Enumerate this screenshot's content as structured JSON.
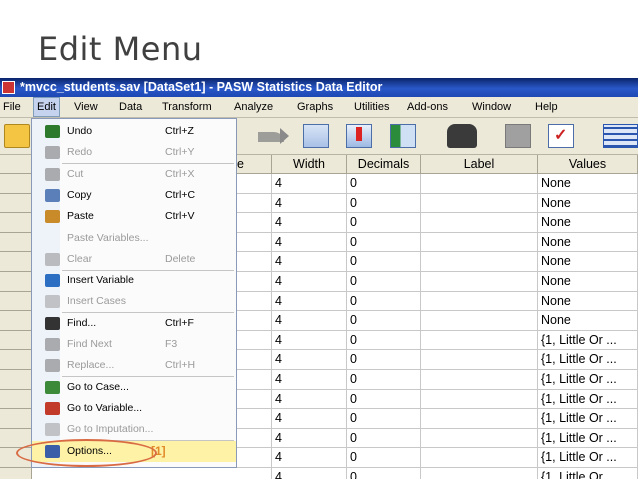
{
  "slide": {
    "title": "Edit Menu"
  },
  "window": {
    "title": "*mvcc_students.sav [DataSet1] - PASW Statistics Data Editor"
  },
  "menubar": {
    "items": [
      "File",
      "Edit",
      "View",
      "Data",
      "Transform",
      "Analyze",
      "Graphs",
      "Utilities",
      "Add-ons",
      "Window",
      "Help"
    ],
    "active": "Edit"
  },
  "toolbar": {
    "icons": [
      "open-folder-icon",
      "redo-arrow-icon",
      "go-to-case-icon",
      "go-to-variable-icon",
      "insert-variable-icon",
      "find-binoculars-icon",
      "disabled-grid-icon",
      "check-icon",
      "data-grid-icon"
    ]
  },
  "grid": {
    "columns": [
      "e",
      "Width",
      "Decimals",
      "Label",
      "Values"
    ],
    "rows": [
      {
        "width": "4",
        "decimals": "0",
        "label": "",
        "values": "None"
      },
      {
        "width": "4",
        "decimals": "0",
        "label": "",
        "values": "None"
      },
      {
        "width": "4",
        "decimals": "0",
        "label": "",
        "values": "None"
      },
      {
        "width": "4",
        "decimals": "0",
        "label": "",
        "values": "None"
      },
      {
        "width": "4",
        "decimals": "0",
        "label": "",
        "values": "None"
      },
      {
        "width": "4",
        "decimals": "0",
        "label": "",
        "values": "None"
      },
      {
        "width": "4",
        "decimals": "0",
        "label": "",
        "values": "None"
      },
      {
        "width": "4",
        "decimals": "0",
        "label": "",
        "values": "None"
      },
      {
        "width": "4",
        "decimals": "0",
        "label": "",
        "values": "{1, Little Or ..."
      },
      {
        "width": "4",
        "decimals": "0",
        "label": "",
        "values": "{1, Little Or ..."
      },
      {
        "width": "4",
        "decimals": "0",
        "label": "",
        "values": "{1, Little Or ..."
      },
      {
        "width": "4",
        "decimals": "0",
        "label": "",
        "values": "{1, Little Or ..."
      },
      {
        "width": "4",
        "decimals": "0",
        "label": "",
        "values": "{1, Little Or ..."
      },
      {
        "width": "4",
        "decimals": "0",
        "label": "",
        "values": "{1, Little Or ..."
      },
      {
        "width": "4",
        "decimals": "0",
        "label": "",
        "values": "{1, Little Or ..."
      },
      {
        "width": "4",
        "decimals": "0",
        "label": "",
        "values": "{1, Little Or ..."
      }
    ]
  },
  "edit_menu": {
    "items": [
      {
        "label": "Undo",
        "shortcut": "Ctrl+Z",
        "enabled": true,
        "icon": "undo-icon",
        "color": "#2d7a2d"
      },
      {
        "label": "Redo",
        "shortcut": "Ctrl+Y",
        "enabled": false,
        "icon": "redo-icon",
        "color": "#555555"
      },
      {
        "label": "Cut",
        "shortcut": "Ctrl+X",
        "enabled": false,
        "icon": "scissors-icon",
        "color": "#555555"
      },
      {
        "label": "Copy",
        "shortcut": "Ctrl+C",
        "enabled": true,
        "icon": "copy-icon",
        "color": "#5b7fb8"
      },
      {
        "label": "Paste",
        "shortcut": "Ctrl+V",
        "enabled": true,
        "icon": "paste-icon",
        "color": "#c98a2a"
      },
      {
        "label": "Paste Variables...",
        "shortcut": "",
        "enabled": false,
        "icon": "",
        "color": ""
      },
      {
        "label": "Clear",
        "shortcut": "Delete",
        "enabled": false,
        "icon": "eraser-icon",
        "color": "#777777"
      },
      {
        "label": "Insert Variable",
        "shortcut": "",
        "enabled": true,
        "icon": "insert-variable-icon",
        "color": "#2b6ec2"
      },
      {
        "label": "Insert Cases",
        "shortcut": "",
        "enabled": false,
        "icon": "insert-cases-icon",
        "color": "#888888"
      },
      {
        "label": "Find...",
        "shortcut": "Ctrl+F",
        "enabled": true,
        "icon": "binoculars-icon",
        "color": "#333333"
      },
      {
        "label": "Find Next",
        "shortcut": "F3",
        "enabled": false,
        "icon": "binoculars-icon",
        "color": "#555555"
      },
      {
        "label": "Replace...",
        "shortcut": "Ctrl+H",
        "enabled": false,
        "icon": "replace-icon",
        "color": "#555555"
      },
      {
        "label": "Go to Case...",
        "shortcut": "",
        "enabled": true,
        "icon": "go-to-case-icon",
        "color": "#3a8a3a"
      },
      {
        "label": "Go to Variable...",
        "shortcut": "",
        "enabled": true,
        "icon": "go-to-variable-icon",
        "color": "#c23a2a"
      },
      {
        "label": "Go to Imputation...",
        "shortcut": "",
        "enabled": false,
        "icon": "go-to-imputation-icon",
        "color": "#888888"
      },
      {
        "label": "Options...",
        "shortcut": "[1]",
        "enabled": true,
        "icon": "options-icon",
        "color": "#3b5ea8",
        "highlight": true
      }
    ]
  },
  "colors": {
    "title_bar": "#0a246a",
    "menu_highlight": "#fdf2a6",
    "annotation_ring": "#d96b44",
    "marker": "#e08a2a"
  }
}
